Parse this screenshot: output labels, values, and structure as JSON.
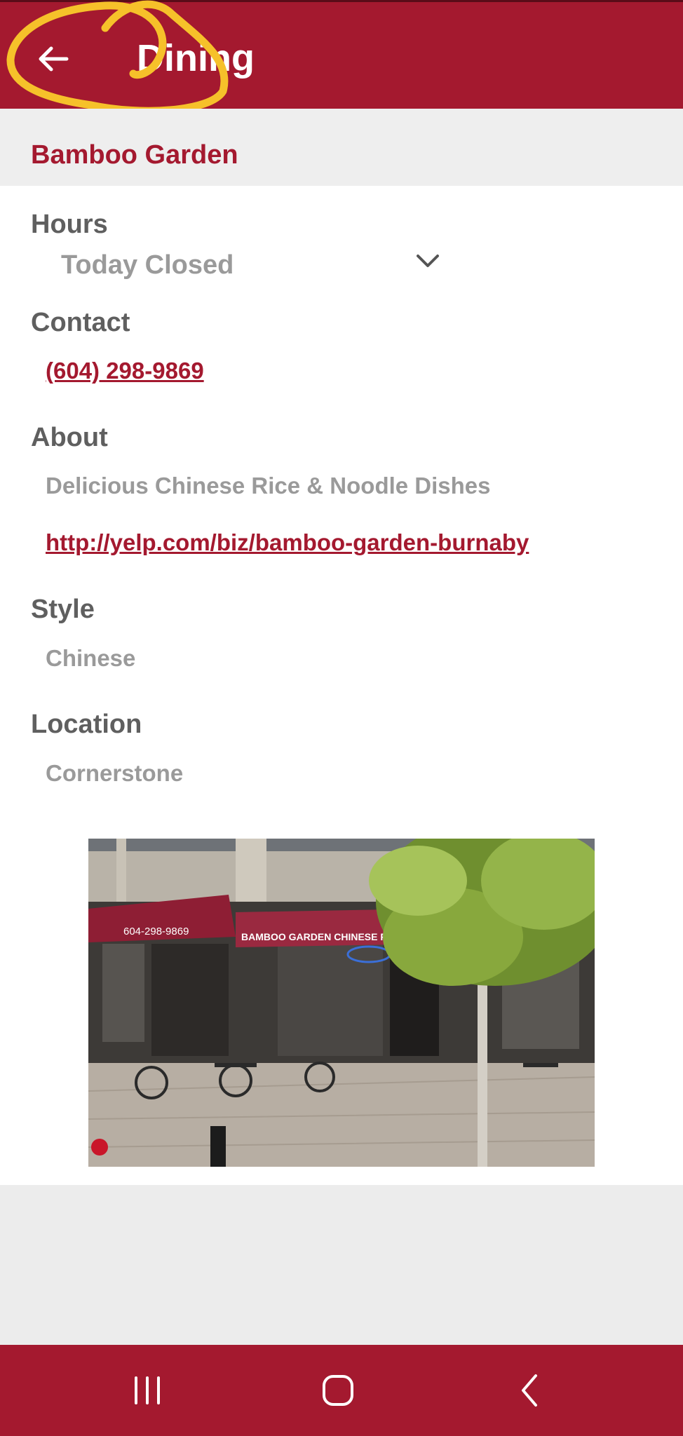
{
  "app_bar": {
    "title": "Dining",
    "back_icon": "arrow-left-icon"
  },
  "restaurant": {
    "name": "Bamboo Garden"
  },
  "hours": {
    "label": "Hours",
    "value": "Today Closed",
    "expand_icon": "chevron-down-icon"
  },
  "contact": {
    "label": "Contact",
    "phone": "(604) 298-9869"
  },
  "about": {
    "label": "About",
    "description": "Delicious Chinese Rice & Noodle Dishes",
    "link": "http://yelp.com/biz/bamboo-garden-burnaby"
  },
  "style": {
    "label": "Style",
    "value": "Chinese"
  },
  "location": {
    "label": "Location",
    "value": "Cornerstone"
  },
  "photo": {
    "phone_on_awning": "604-298-9869",
    "sign_text": "BAMBOO GARDEN CHINESE RESTAURANT"
  },
  "system_nav": {
    "recent_icon": "recent-apps-icon",
    "home_icon": "home-icon",
    "back_icon": "back-chevron-icon"
  },
  "colors": {
    "brand": "#a4192f",
    "label_gray": "#5f5f5f",
    "value_gray": "#9a9a9a",
    "background": "#ececec",
    "annotation": "#f6c12a"
  }
}
